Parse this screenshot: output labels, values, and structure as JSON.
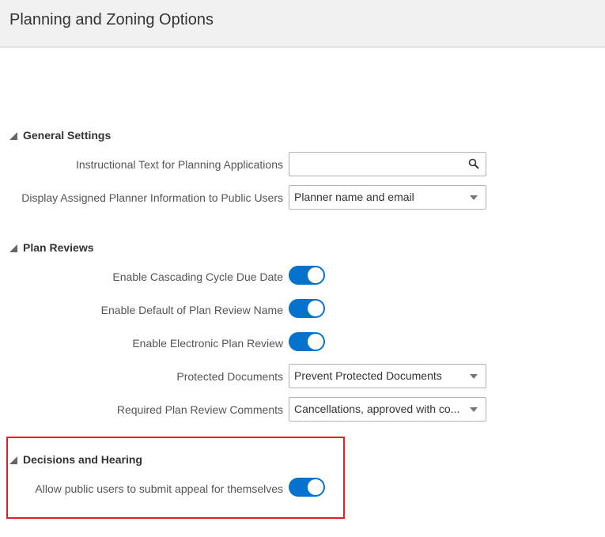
{
  "header": {
    "title": "Planning and Zoning Options"
  },
  "general_settings": {
    "heading": "General Settings",
    "instructional_text": {
      "label": "Instructional Text for Planning Applications",
      "value": ""
    },
    "display_planner": {
      "label": "Display Assigned Planner Information to Public Users",
      "value": "Planner name and email"
    }
  },
  "plan_reviews": {
    "heading": "Plan Reviews",
    "cascading": {
      "label": "Enable Cascading Cycle Due Date",
      "on": true
    },
    "default_name": {
      "label": "Enable Default of Plan Review Name",
      "on": true
    },
    "electronic": {
      "label": "Enable Electronic Plan Review",
      "on": true
    },
    "protected_docs": {
      "label": "Protected Documents",
      "value": "Prevent Protected Documents"
    },
    "required_comments": {
      "label": "Required Plan Review Comments",
      "value": "Cancellations, approved with co..."
    }
  },
  "decisions": {
    "heading": "Decisions and Hearing",
    "appeal": {
      "label": "Allow public users to submit appeal for themselves",
      "on": true
    }
  },
  "colors": {
    "accent": "#0572ce",
    "highlight": "#e3202a",
    "header_bg": "#f1f1f1"
  }
}
